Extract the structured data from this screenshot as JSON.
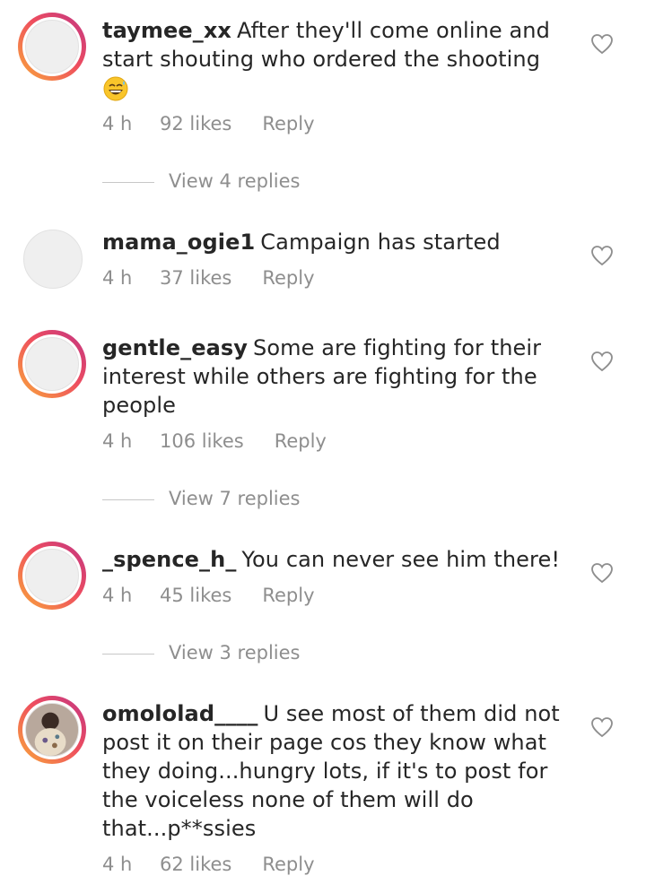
{
  "comments": [
    {
      "username": "taymee_xx",
      "text": "After they'll come online and start shouting who ordered the shooting",
      "emoji": "grinning-sweat-emoji",
      "time": "4 h",
      "likes": "92 likes",
      "reply": "Reply",
      "view_replies": "View 4 replies"
    },
    {
      "username": "mama_ogie1",
      "text": "Campaign has started",
      "time": "4 h",
      "likes": "37 likes",
      "reply": "Reply"
    },
    {
      "username": "gentle_easy",
      "text": "Some are fighting for their interest while others are fighting for the people",
      "time": "4 h",
      "likes": "106 likes",
      "reply": "Reply",
      "view_replies": "View 7 replies"
    },
    {
      "username": "_spence_h_",
      "text": "You can never see him there!",
      "time": "4 h",
      "likes": "45 likes",
      "reply": "Reply",
      "view_replies": "View 3 replies"
    },
    {
      "username": "omololad____",
      "text": "U see most of them did not post it on their page cos they know what they doing...hungry lots, if it's to post for the voiceless none of them will do that...p**ssies",
      "time": "4 h",
      "likes": "62 likes",
      "reply": "Reply"
    }
  ],
  "icons": {
    "like": "heart-outline-icon",
    "accent_ring": [
      "#f9a93a",
      "#ee4d5f",
      "#c13584"
    ]
  }
}
